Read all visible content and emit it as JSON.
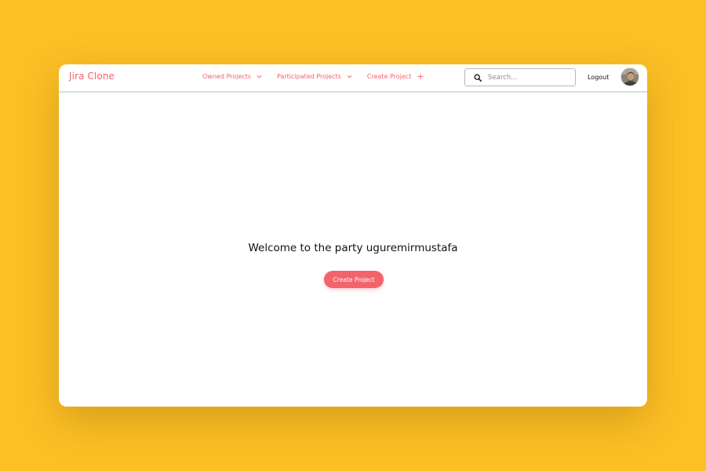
{
  "brand": {
    "name": "Jira Clone"
  },
  "nav": {
    "owned": "Owned Projects",
    "participated": "Participated Projects",
    "create": "Create Project"
  },
  "search": {
    "placeholder": "Search...",
    "value": ""
  },
  "user": {
    "logout_label": "Logout"
  },
  "main": {
    "welcome": "Welcome to the party uguremirmustafa",
    "cta_label": "Create Project"
  },
  "colors": {
    "background": "#fcbf24",
    "accent": "#f2636a",
    "surface": "#ffffff"
  },
  "icons": [
    "chevron-down-icon",
    "plus-icon",
    "search-icon",
    "user-avatar"
  ]
}
